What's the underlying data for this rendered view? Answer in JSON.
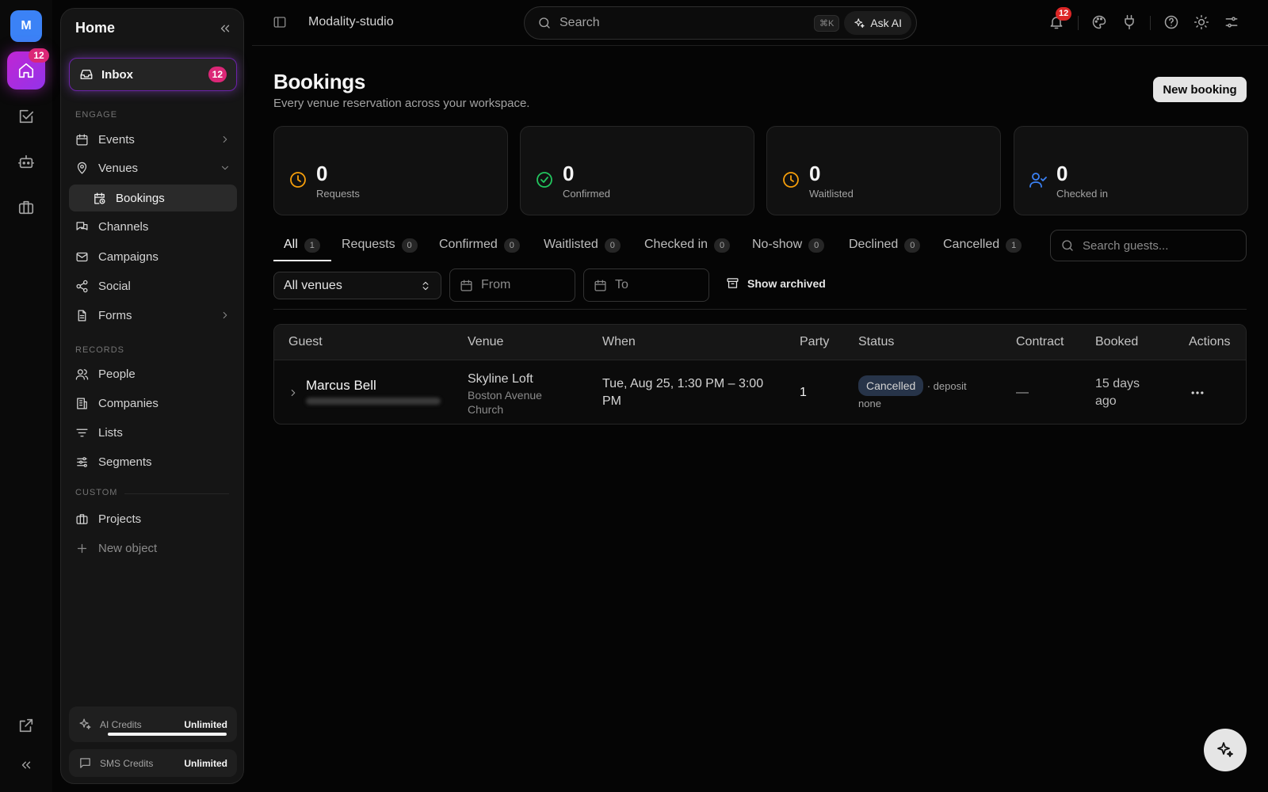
{
  "rail": {
    "avatar_initial": "M",
    "home_badge": "12"
  },
  "sidebar": {
    "title": "Home",
    "inbox": {
      "label": "Inbox",
      "badge": "12"
    },
    "sections": {
      "engage": "ENGAGE",
      "records": "RECORDS",
      "custom": "CUSTOM"
    },
    "items": {
      "events": "Events",
      "venues": "Venues",
      "bookings": "Bookings",
      "channels": "Channels",
      "campaigns": "Campaigns",
      "social": "Social",
      "forms": "Forms",
      "people": "People",
      "companies": "Companies",
      "lists": "Lists",
      "segments": "Segments",
      "projects": "Projects",
      "new_object": "New object"
    },
    "credits": {
      "ai_label": "AI Credits",
      "ai_value": "Unlimited",
      "ai_fill_fraction": 1.0,
      "sms_label": "SMS Credits",
      "sms_value": "Unlimited"
    }
  },
  "topbar": {
    "workspace": "Modality-studio",
    "search_placeholder": "Search",
    "shortcut": "⌘K",
    "ask_ai": "Ask AI",
    "notification_badge": "12"
  },
  "page": {
    "title": "Bookings",
    "subtitle": "Every venue reservation across your workspace.",
    "new_button": "New booking"
  },
  "stats": [
    {
      "value": "0",
      "label": "Requests",
      "color": "#f59e0b",
      "icon": "clock-icon"
    },
    {
      "value": "0",
      "label": "Confirmed",
      "color": "#22c55e",
      "icon": "check-circle-icon"
    },
    {
      "value": "0",
      "label": "Waitlisted",
      "color": "#f59e0b",
      "icon": "clock-icon"
    },
    {
      "value": "0",
      "label": "Checked in",
      "color": "#3b82f6",
      "icon": "user-check-icon"
    }
  ],
  "tabs": [
    {
      "label": "All",
      "count": "1"
    },
    {
      "label": "Requests",
      "count": "0"
    },
    {
      "label": "Confirmed",
      "count": "0"
    },
    {
      "label": "Waitlisted",
      "count": "0"
    },
    {
      "label": "Checked in",
      "count": "0"
    },
    {
      "label": "No-show",
      "count": "0"
    },
    {
      "label": "Declined",
      "count": "0"
    },
    {
      "label": "Cancelled",
      "count": "1"
    }
  ],
  "filters": {
    "guest_search_placeholder": "Search guests...",
    "venue_select": "All venues",
    "from_placeholder": "From",
    "to_placeholder": "To",
    "show_archived": "Show archived"
  },
  "table": {
    "headers": [
      "Guest",
      "Venue",
      "When",
      "Party",
      "Status",
      "Contract",
      "Booked",
      "Actions"
    ],
    "rows": [
      {
        "guest": "Marcus Bell",
        "venue": "Skyline Loft",
        "venue_sub_1": "Boston Avenue",
        "venue_sub_2": "Church",
        "when_1": "Tue, Aug 25, 1:30 PM – 3:00",
        "when_2": "PM",
        "party": "1",
        "status": "Cancelled",
        "status_note_1": "· deposit",
        "status_note_2": "none",
        "contract": "—",
        "booked_1": "15 days",
        "booked_2": "ago"
      }
    ]
  }
}
